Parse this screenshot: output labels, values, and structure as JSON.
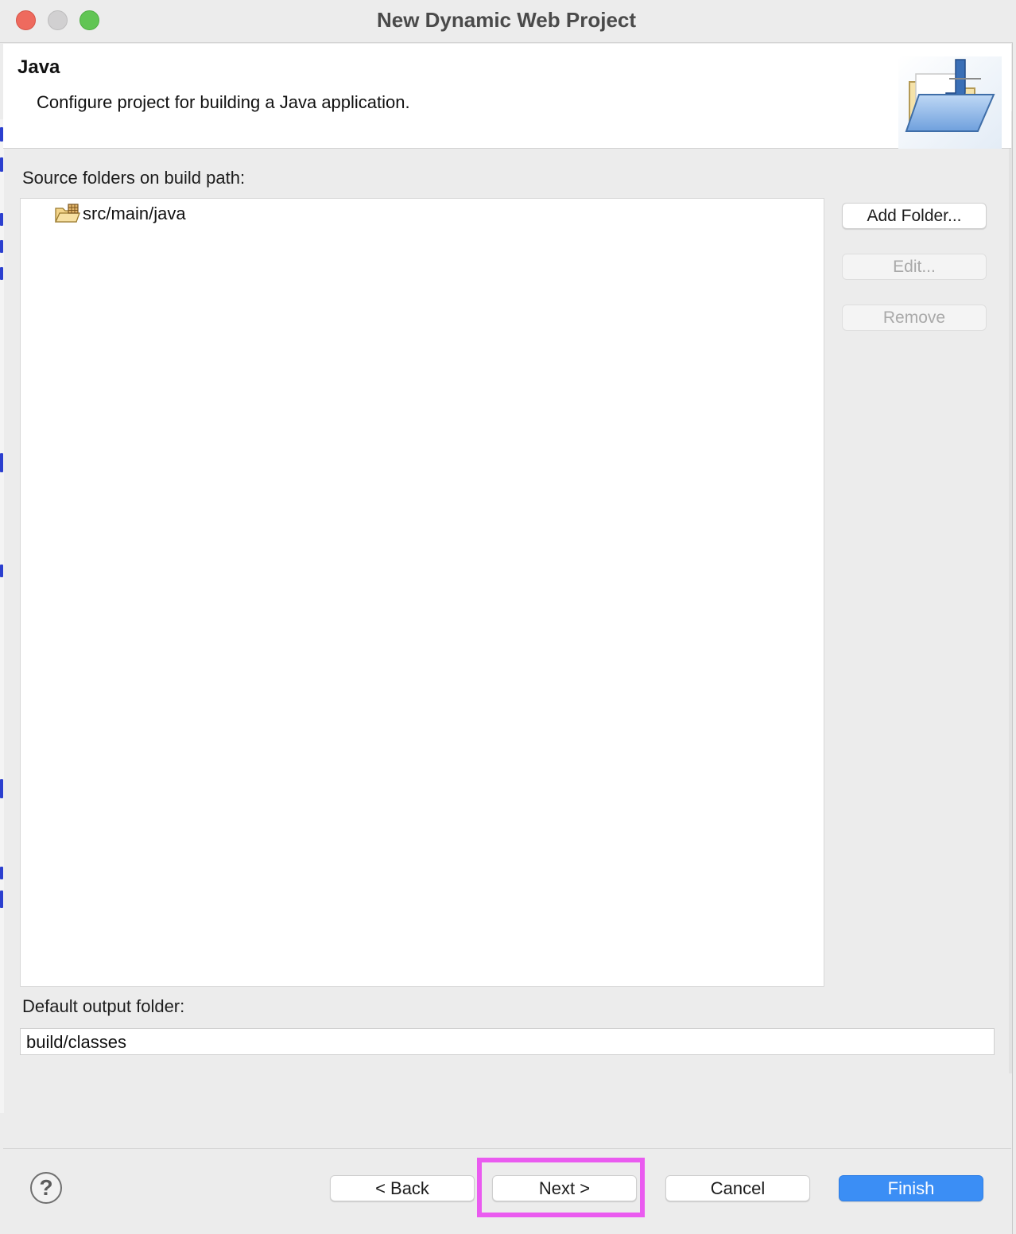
{
  "window": {
    "title": "New Dynamic Web Project"
  },
  "banner": {
    "title": "Java",
    "description": "Configure project for building a Java application.",
    "icon": "java-folder-wizard-icon"
  },
  "source": {
    "label": "Source folders on build path:",
    "folders": [
      {
        "icon": "package-folder-icon",
        "label": "src/main/java"
      }
    ],
    "buttons": {
      "add": "Add Folder...",
      "edit": "Edit...",
      "remove": "Remove"
    }
  },
  "output": {
    "label": "Default output folder:",
    "value": "build/classes"
  },
  "footer": {
    "help": "?",
    "back": "< Back",
    "next": "Next >",
    "cancel": "Cancel",
    "finish": "Finish"
  },
  "colors": {
    "primary_button": "#3b8ef5",
    "highlight": "#ea5bf0"
  }
}
